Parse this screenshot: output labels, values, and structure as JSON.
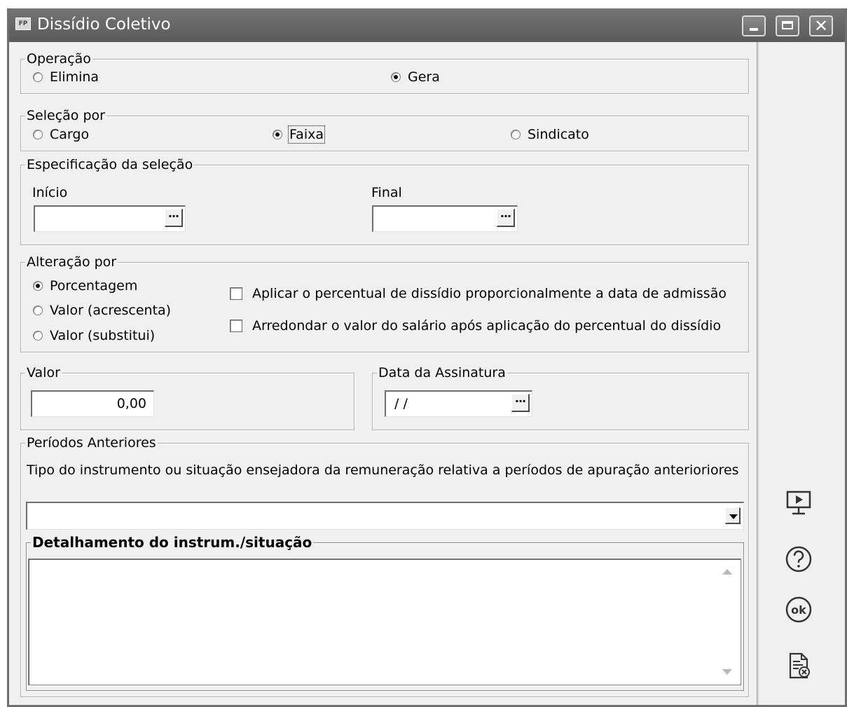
{
  "window": {
    "title": "Dissídio Coletivo",
    "app_badge": "FP"
  },
  "operacao": {
    "legend": "Operação",
    "options": [
      "Elimina",
      "Gera"
    ],
    "selected": "Gera"
  },
  "selecao": {
    "legend": "Seleção por",
    "options": [
      "Cargo",
      "Faixa",
      "Sindicato"
    ],
    "selected": "Faixa"
  },
  "especificacao": {
    "legend": "Especificação da seleção",
    "inicio_label": "Início",
    "inicio_value": "",
    "final_label": "Final",
    "final_value": "",
    "ellipsis": "..."
  },
  "alteracao": {
    "legend": "Alteração por",
    "options": [
      "Porcentagem",
      "Valor (acrescenta)",
      "Valor (substitui)"
    ],
    "selected": "Porcentagem",
    "checks": [
      {
        "label": "Aplicar o percentual de dissídio proporcionalmente a data de admissão",
        "checked": false
      },
      {
        "label": "Arredondar o valor do salário após aplicação do percentual do dissídio",
        "checked": false
      }
    ]
  },
  "valor": {
    "legend": "Valor",
    "value": "0,00"
  },
  "data_assinatura": {
    "legend": "Data da Assinatura",
    "value": " / /"
  },
  "periodos": {
    "legend": "Períodos Anteriores",
    "description": "Tipo do instrumento ou situação ensejadora da remuneração relativa a períodos de apuração anterioriores",
    "selected_value": "",
    "detalhamento_legend": "Detalhamento do instrum./situação",
    "detalhamento_text": ""
  },
  "sidebar": {
    "icons": [
      "presentation-icon",
      "help-icon",
      "ok-icon",
      "cancel-document-icon"
    ],
    "ok_text": "ok"
  }
}
